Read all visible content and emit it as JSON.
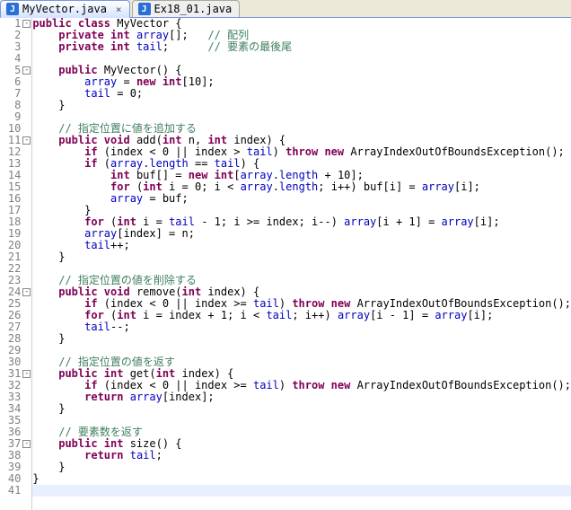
{
  "tabs": [
    {
      "icon": "J",
      "label": "MyVector.java",
      "active": true,
      "close": "×"
    },
    {
      "icon": "J",
      "label": "Ex18_01.java",
      "active": false,
      "close": ""
    }
  ],
  "gutter": {
    "lines": 41,
    "folds": [
      1,
      5,
      11,
      24,
      31,
      37
    ]
  },
  "code": {
    "lines": [
      [
        [
          "k",
          "public class"
        ],
        [
          "n",
          " MyVector {"
        ]
      ],
      [
        [
          "n",
          "    "
        ],
        [
          "k",
          "private int"
        ],
        [
          "n",
          " "
        ],
        [
          "f",
          "array"
        ],
        [
          "n",
          "[];   "
        ],
        [
          "c",
          "// 配列"
        ]
      ],
      [
        [
          "n",
          "    "
        ],
        [
          "k",
          "private int"
        ],
        [
          "n",
          " "
        ],
        [
          "f",
          "tail"
        ],
        [
          "n",
          ";      "
        ],
        [
          "c",
          "// 要素の最後尾"
        ]
      ],
      [
        [
          "n",
          ""
        ]
      ],
      [
        [
          "n",
          "    "
        ],
        [
          "k",
          "public"
        ],
        [
          "n",
          " MyVector() {"
        ]
      ],
      [
        [
          "n",
          "        "
        ],
        [
          "f",
          "array"
        ],
        [
          "n",
          " = "
        ],
        [
          "k",
          "new int"
        ],
        [
          "n",
          "[10];"
        ]
      ],
      [
        [
          "n",
          "        "
        ],
        [
          "f",
          "tail"
        ],
        [
          "n",
          " = 0;"
        ]
      ],
      [
        [
          "n",
          "    }"
        ]
      ],
      [
        [
          "n",
          ""
        ]
      ],
      [
        [
          "n",
          "    "
        ],
        [
          "c",
          "// 指定位置に値を追加する"
        ]
      ],
      [
        [
          "n",
          "    "
        ],
        [
          "k",
          "public void"
        ],
        [
          "n",
          " add("
        ],
        [
          "k",
          "int"
        ],
        [
          "n",
          " n, "
        ],
        [
          "k",
          "int"
        ],
        [
          "n",
          " index) {"
        ]
      ],
      [
        [
          "n",
          "        "
        ],
        [
          "k",
          "if"
        ],
        [
          "n",
          " (index < 0 || index > "
        ],
        [
          "f",
          "tail"
        ],
        [
          "n",
          ") "
        ],
        [
          "k",
          "throw new"
        ],
        [
          "n",
          " ArrayIndexOutOfBoundsException();"
        ]
      ],
      [
        [
          "n",
          "        "
        ],
        [
          "k",
          "if"
        ],
        [
          "n",
          " ("
        ],
        [
          "f",
          "array"
        ],
        [
          "n",
          "."
        ],
        [
          "f",
          "length"
        ],
        [
          "n",
          " == "
        ],
        [
          "f",
          "tail"
        ],
        [
          "n",
          ") {"
        ]
      ],
      [
        [
          "n",
          "            "
        ],
        [
          "k",
          "int"
        ],
        [
          "n",
          " buf[] = "
        ],
        [
          "k",
          "new int"
        ],
        [
          "n",
          "["
        ],
        [
          "f",
          "array"
        ],
        [
          "n",
          "."
        ],
        [
          "f",
          "length"
        ],
        [
          "n",
          " + 10];"
        ]
      ],
      [
        [
          "n",
          "            "
        ],
        [
          "k",
          "for"
        ],
        [
          "n",
          " ("
        ],
        [
          "k",
          "int"
        ],
        [
          "n",
          " i = 0; i < "
        ],
        [
          "f",
          "array"
        ],
        [
          "n",
          "."
        ],
        [
          "f",
          "length"
        ],
        [
          "n",
          "; i++) buf[i] = "
        ],
        [
          "f",
          "array"
        ],
        [
          "n",
          "[i];"
        ]
      ],
      [
        [
          "n",
          "            "
        ],
        [
          "f",
          "array"
        ],
        [
          "n",
          " = buf;"
        ]
      ],
      [
        [
          "n",
          "        }"
        ]
      ],
      [
        [
          "n",
          "        "
        ],
        [
          "k",
          "for"
        ],
        [
          "n",
          " ("
        ],
        [
          "k",
          "int"
        ],
        [
          "n",
          " i = "
        ],
        [
          "f",
          "tail"
        ],
        [
          "n",
          " - 1; i >= index; i--) "
        ],
        [
          "f",
          "array"
        ],
        [
          "n",
          "[i + 1] = "
        ],
        [
          "f",
          "array"
        ],
        [
          "n",
          "[i];"
        ]
      ],
      [
        [
          "n",
          "        "
        ],
        [
          "f",
          "array"
        ],
        [
          "n",
          "[index] = n;"
        ]
      ],
      [
        [
          "n",
          "        "
        ],
        [
          "f",
          "tail"
        ],
        [
          "n",
          "++;"
        ]
      ],
      [
        [
          "n",
          "    }"
        ]
      ],
      [
        [
          "n",
          ""
        ]
      ],
      [
        [
          "n",
          "    "
        ],
        [
          "c",
          "// 指定位置の値を削除する"
        ]
      ],
      [
        [
          "n",
          "    "
        ],
        [
          "k",
          "public void"
        ],
        [
          "n",
          " remove("
        ],
        [
          "k",
          "int"
        ],
        [
          "n",
          " index) {"
        ]
      ],
      [
        [
          "n",
          "        "
        ],
        [
          "k",
          "if"
        ],
        [
          "n",
          " (index < 0 || index >= "
        ],
        [
          "f",
          "tail"
        ],
        [
          "n",
          ") "
        ],
        [
          "k",
          "throw new"
        ],
        [
          "n",
          " ArrayIndexOutOfBoundsException();"
        ]
      ],
      [
        [
          "n",
          "        "
        ],
        [
          "k",
          "for"
        ],
        [
          "n",
          " ("
        ],
        [
          "k",
          "int"
        ],
        [
          "n",
          " i = index + 1; i < "
        ],
        [
          "f",
          "tail"
        ],
        [
          "n",
          "; i++) "
        ],
        [
          "f",
          "array"
        ],
        [
          "n",
          "[i - 1] = "
        ],
        [
          "f",
          "array"
        ],
        [
          "n",
          "[i];"
        ]
      ],
      [
        [
          "n",
          "        "
        ],
        [
          "f",
          "tail"
        ],
        [
          "n",
          "--;"
        ]
      ],
      [
        [
          "n",
          "    }"
        ]
      ],
      [
        [
          "n",
          ""
        ]
      ],
      [
        [
          "n",
          "    "
        ],
        [
          "c",
          "// 指定位置の値を返す"
        ]
      ],
      [
        [
          "n",
          "    "
        ],
        [
          "k",
          "public int"
        ],
        [
          "n",
          " get("
        ],
        [
          "k",
          "int"
        ],
        [
          "n",
          " index) {"
        ]
      ],
      [
        [
          "n",
          "        "
        ],
        [
          "k",
          "if"
        ],
        [
          "n",
          " (index < 0 || index >= "
        ],
        [
          "f",
          "tail"
        ],
        [
          "n",
          ") "
        ],
        [
          "k",
          "throw new"
        ],
        [
          "n",
          " ArrayIndexOutOfBoundsException();"
        ]
      ],
      [
        [
          "n",
          "        "
        ],
        [
          "k",
          "return"
        ],
        [
          "n",
          " "
        ],
        [
          "f",
          "array"
        ],
        [
          "n",
          "[index];"
        ]
      ],
      [
        [
          "n",
          "    }"
        ]
      ],
      [
        [
          "n",
          ""
        ]
      ],
      [
        [
          "n",
          "    "
        ],
        [
          "c",
          "// 要素数を返す"
        ]
      ],
      [
        [
          "n",
          "    "
        ],
        [
          "k",
          "public int"
        ],
        [
          "n",
          " size() {"
        ]
      ],
      [
        [
          "n",
          "        "
        ],
        [
          "k",
          "return"
        ],
        [
          "n",
          " "
        ],
        [
          "f",
          "tail"
        ],
        [
          "n",
          ";"
        ]
      ],
      [
        [
          "n",
          "    }"
        ]
      ],
      [
        [
          "n",
          "}"
        ]
      ],
      [
        [
          "n",
          ""
        ]
      ]
    ],
    "current_line": 41
  }
}
